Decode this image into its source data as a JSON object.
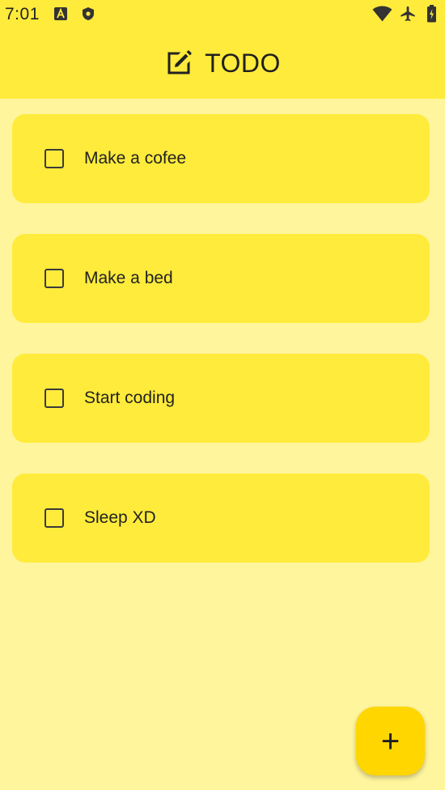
{
  "status_bar": {
    "time": "7:01",
    "left_icons": [
      "a-badge-icon",
      "shield-icon"
    ],
    "right_icons": [
      "wifi-icon",
      "airplane-icon",
      "battery-charging-icon"
    ]
  },
  "app_bar": {
    "icon": "edit-note-icon",
    "title": "TODO"
  },
  "todos": [
    {
      "label": "Make a cofee",
      "checked": false
    },
    {
      "label": "Make a bed",
      "checked": false
    },
    {
      "label": "Start coding",
      "checked": false
    },
    {
      "label": "Sleep XD",
      "checked": false
    }
  ],
  "fab": {
    "label": "+",
    "icon": "plus-icon"
  },
  "colors": {
    "background": "#FFF59D",
    "app_bar": "#FFEB3B",
    "card": "#FFEB3B",
    "fab": "#FFD600"
  }
}
